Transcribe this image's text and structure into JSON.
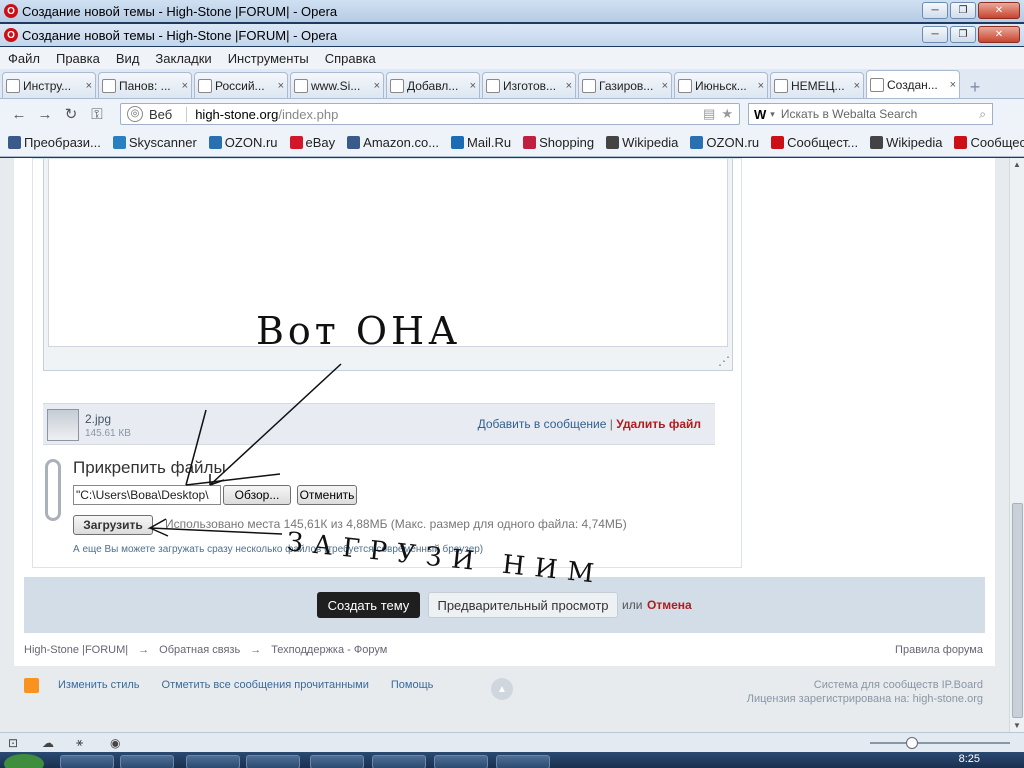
{
  "window": {
    "title_back": "Создание новой темы - High-Stone |FORUM| - Opera",
    "title_front": "Создание новой темы - High-Stone |FORUM| - Opera"
  },
  "menu": [
    "Файл",
    "Правка",
    "Вид",
    "Закладки",
    "Инструменты",
    "Справка"
  ],
  "tabs": [
    {
      "label": "Инстру...",
      "icon": "page-icon"
    },
    {
      "label": "Панов: ...",
      "icon": "page-icon"
    },
    {
      "label": "Россий...",
      "icon": "page-icon"
    },
    {
      "label": "www.Si...",
      "icon": "leaf-icon"
    },
    {
      "label": "Добавл...",
      "icon": "page-icon"
    },
    {
      "label": "Изготов...",
      "icon": "fish-icon"
    },
    {
      "label": "Газиров...",
      "icon": "page-icon"
    },
    {
      "label": "Июньск...",
      "icon": "page-icon"
    },
    {
      "label": "НЕМЕЦ...",
      "icon": "vk-icon"
    },
    {
      "label": "Создан...",
      "icon": "page-icon",
      "active": true
    }
  ],
  "address": {
    "mode": "Веб",
    "domain": "high-stone.org",
    "path": "/index.php"
  },
  "search": {
    "engine": "W",
    "placeholder": "Искать в Webalta Search"
  },
  "bookmarks": [
    {
      "label": "Преобрази...",
      "color": "#3a5a8a"
    },
    {
      "label": "Skyscanner",
      "color": "#2a7fc0"
    },
    {
      "label": "OZON.ru",
      "color": "#2a6fb0"
    },
    {
      "label": "eBay",
      "color": "#d4162b"
    },
    {
      "label": "Amazon.co...",
      "color": "#3a5a8a"
    },
    {
      "label": "Mail.Ru",
      "color": "#1a6cb5"
    },
    {
      "label": "Shopping",
      "color": "#c02040"
    },
    {
      "label": "Wikipedia",
      "color": "#444444"
    },
    {
      "label": "OZON.ru",
      "color": "#2a6fb0"
    },
    {
      "label": "Сообщест...",
      "color": "#cc0f16"
    },
    {
      "label": "Wikipedia",
      "color": "#444444"
    },
    {
      "label": "Сообщест...",
      "color": "#cc0f16"
    }
  ],
  "file": {
    "name": "2.jpg",
    "size": "145.61 КВ",
    "add_link": "Добавить в сообщение",
    "separator": "|",
    "delete_link": "Удалить файл"
  },
  "attach": {
    "title": "Прикрепить файлы",
    "path_value": "\"C:\\Users\\Вова\\Desktop\\",
    "browse": "Обзор...",
    "cancel": "Отменить",
    "upload": "Загрузить",
    "usage": "Использовано места 145,61К из 4,88МБ (Макс. размер для одного файла: 4,74МБ)",
    "multi": "А еще Вы можете загружать сразу несколько файлов (требуется современный браузер)"
  },
  "actions": {
    "submit": "Создать тему",
    "preview": "Предварительный просмотр",
    "or": "или",
    "cancel": "Отмена"
  },
  "breadcrumb": [
    "High-Stone |FORUM|",
    "→",
    "Обратная связь",
    "→",
    "Техподдержка - Форум"
  ],
  "rules": "Правила форума",
  "footer": {
    "links": [
      "Изменить стиль",
      "Отметить все сообщения прочитанными",
      "Помощь"
    ],
    "line1": "Система для сообществ IP.Board",
    "line2": "Лицензия зарегистрирована на: high-stone.org"
  },
  "handwriting": {
    "top": "Вот ОНА",
    "bottom": "ЗАГРУЗИ НИМ"
  },
  "taskbar": {
    "clock": "8:25"
  }
}
